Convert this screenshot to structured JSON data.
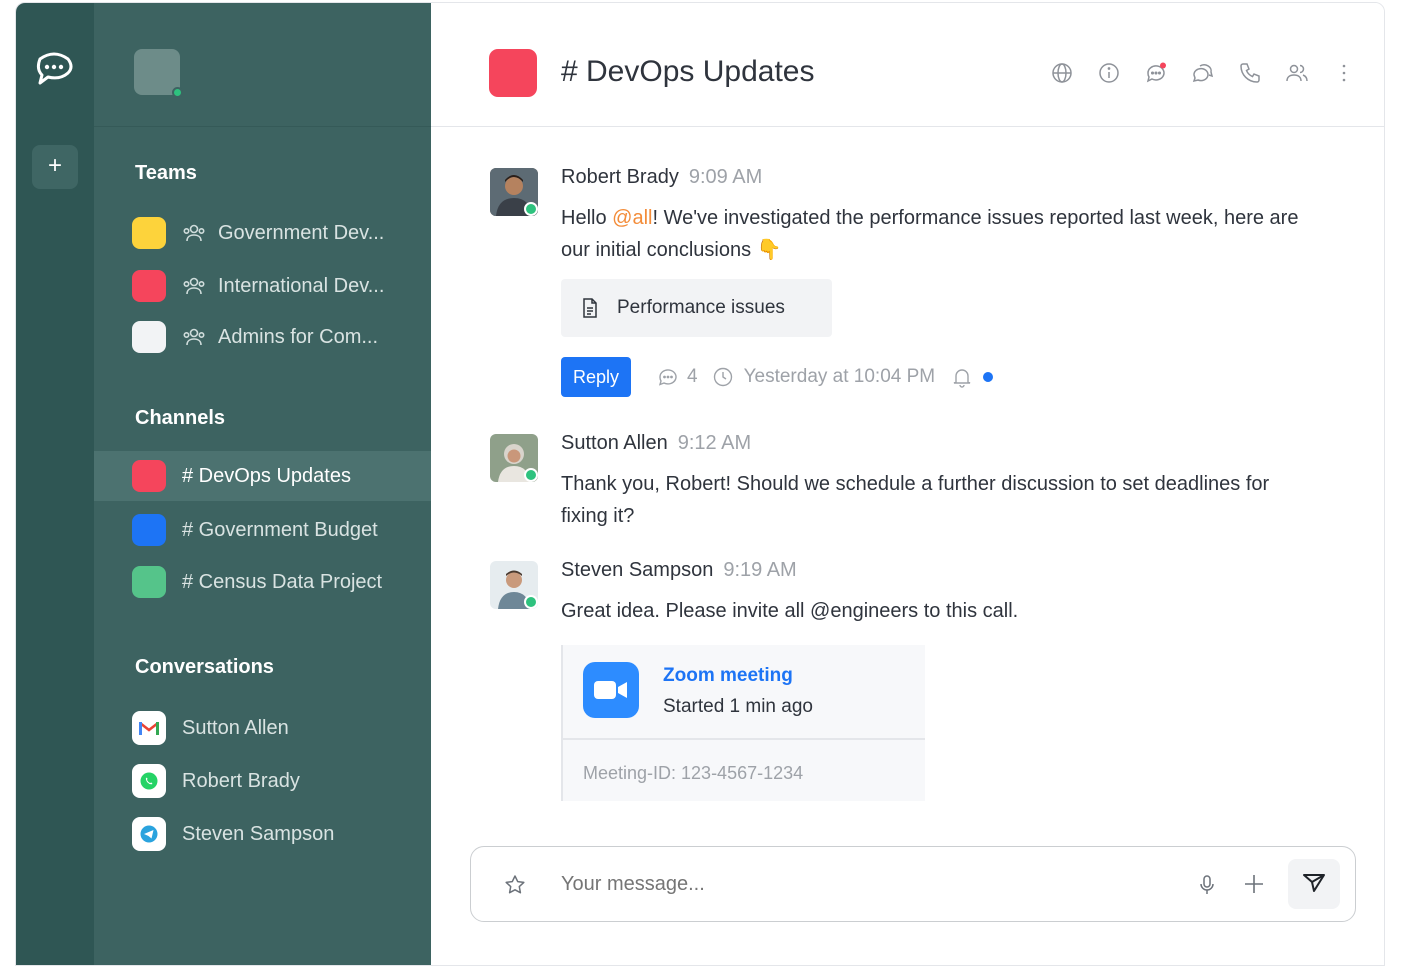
{
  "sidebar": {
    "sections": {
      "teams": "Teams",
      "channels": "Channels",
      "conversations": "Conversations"
    },
    "teams": [
      {
        "label": "Government Dev...",
        "color": "#fdd33b"
      },
      {
        "label": "International Dev...",
        "color": "#f5455c"
      },
      {
        "label": "Admins for Com...",
        "color": "#f2f3f5"
      }
    ],
    "channels": [
      {
        "label": "# DevOps Updates",
        "color": "#f5455c",
        "active": true
      },
      {
        "label": "# Government Budget",
        "color": "#1d74f5",
        "active": false
      },
      {
        "label": "# Census Data Project",
        "color": "#55c48a",
        "active": false
      }
    ],
    "conversations": [
      {
        "label": "Sutton Allen",
        "icon": "gmail-icon"
      },
      {
        "label": "Robert Brady",
        "icon": "whatsapp-icon"
      },
      {
        "label": "Steven Sampson",
        "icon": "telegram-icon"
      }
    ]
  },
  "header": {
    "title": "# DevOps Updates",
    "channel_color": "#f5455c"
  },
  "messages": [
    {
      "author": "Robert Brady",
      "time": "9:09 AM",
      "text_pre": "Hello ",
      "mention": "@all",
      "text_post": "! We've investigated the performance issues reported last week, here are our initial conclusions 👇",
      "attachment": "Performance issues",
      "reply_label": "Reply",
      "reply_count": "4",
      "last_reply": "Yesterday at 10:04 PM"
    },
    {
      "author": "Sutton Allen",
      "time": "9:12 AM",
      "text": "Thank you, Robert! Should we schedule a further discussion to set deadlines for fixing it?"
    },
    {
      "author": "Steven Sampson",
      "time": "9:19 AM",
      "text": "Great idea. Please invite all @engineers to this call.",
      "meeting": {
        "title": "Zoom meeting",
        "status": "Started 1 min ago",
        "meeting_id": "Meeting-ID: 123-4567-1234"
      }
    }
  ],
  "composer": {
    "placeholder": "Your message..."
  },
  "colors": {
    "rail": "#2f5654",
    "sidebar": "#3d6361",
    "accent": "#1d74f5",
    "mention": "#f38c39",
    "online": "#2ec27e"
  }
}
